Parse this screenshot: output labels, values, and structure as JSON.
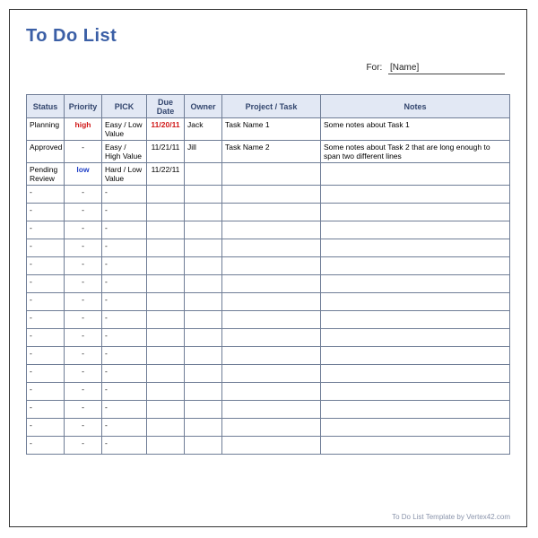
{
  "title": "To Do List",
  "for_label": "For:",
  "for_value": "[Name]",
  "columns": {
    "status": "Status",
    "priority": "Priority",
    "pick": "PICK",
    "due": "Due Date",
    "owner": "Owner",
    "task": "Project / Task",
    "notes": "Notes"
  },
  "rows": [
    {
      "status": "Planning",
      "priority": "high",
      "priority_class": "prio-high",
      "pick": "Easy / Low Value",
      "due": "11/20/11",
      "due_class": "due-hot",
      "owner": "Jack",
      "task": "Task Name 1",
      "notes": "Some notes about Task 1"
    },
    {
      "status": "Approved",
      "priority": "-",
      "priority_class": "",
      "pick": "Easy / High Value",
      "due": "11/21/11",
      "due_class": "",
      "owner": "Jill",
      "task": "Task Name 2",
      "notes": "Some notes about Task 2 that are long enough to span two different lines"
    },
    {
      "status": "Pending Review",
      "priority": "low",
      "priority_class": "prio-low",
      "pick": "Hard / Low Value",
      "due": "11/22/11",
      "due_class": "",
      "owner": "",
      "task": "",
      "notes": ""
    },
    {
      "status": "-",
      "priority": "-",
      "priority_class": "",
      "pick": "-",
      "due": "",
      "due_class": "",
      "owner": "",
      "task": "",
      "notes": ""
    },
    {
      "status": "-",
      "priority": "-",
      "priority_class": "",
      "pick": "-",
      "due": "",
      "due_class": "",
      "owner": "",
      "task": "",
      "notes": ""
    },
    {
      "status": "-",
      "priority": "-",
      "priority_class": "",
      "pick": "-",
      "due": "",
      "due_class": "",
      "owner": "",
      "task": "",
      "notes": ""
    },
    {
      "status": "-",
      "priority": "-",
      "priority_class": "",
      "pick": "-",
      "due": "",
      "due_class": "",
      "owner": "",
      "task": "",
      "notes": ""
    },
    {
      "status": "-",
      "priority": "-",
      "priority_class": "",
      "pick": "-",
      "due": "",
      "due_class": "",
      "owner": "",
      "task": "",
      "notes": ""
    },
    {
      "status": "-",
      "priority": "-",
      "priority_class": "",
      "pick": "-",
      "due": "",
      "due_class": "",
      "owner": "",
      "task": "",
      "notes": ""
    },
    {
      "status": "-",
      "priority": "-",
      "priority_class": "",
      "pick": "-",
      "due": "",
      "due_class": "",
      "owner": "",
      "task": "",
      "notes": ""
    },
    {
      "status": "-",
      "priority": "-",
      "priority_class": "",
      "pick": "-",
      "due": "",
      "due_class": "",
      "owner": "",
      "task": "",
      "notes": ""
    },
    {
      "status": "-",
      "priority": "-",
      "priority_class": "",
      "pick": "-",
      "due": "",
      "due_class": "",
      "owner": "",
      "task": "",
      "notes": ""
    },
    {
      "status": "-",
      "priority": "-",
      "priority_class": "",
      "pick": "-",
      "due": "",
      "due_class": "",
      "owner": "",
      "task": "",
      "notes": ""
    },
    {
      "status": "-",
      "priority": "-",
      "priority_class": "",
      "pick": "-",
      "due": "",
      "due_class": "",
      "owner": "",
      "task": "",
      "notes": ""
    },
    {
      "status": "-",
      "priority": "-",
      "priority_class": "",
      "pick": "-",
      "due": "",
      "due_class": "",
      "owner": "",
      "task": "",
      "notes": ""
    },
    {
      "status": "-",
      "priority": "-",
      "priority_class": "",
      "pick": "-",
      "due": "",
      "due_class": "",
      "owner": "",
      "task": "",
      "notes": ""
    },
    {
      "status": "-",
      "priority": "-",
      "priority_class": "",
      "pick": "-",
      "due": "",
      "due_class": "",
      "owner": "",
      "task": "",
      "notes": ""
    },
    {
      "status": "-",
      "priority": "-",
      "priority_class": "",
      "pick": "-",
      "due": "",
      "due_class": "",
      "owner": "",
      "task": "",
      "notes": ""
    }
  ],
  "footer": "To Do List Template by Vertex42.com"
}
